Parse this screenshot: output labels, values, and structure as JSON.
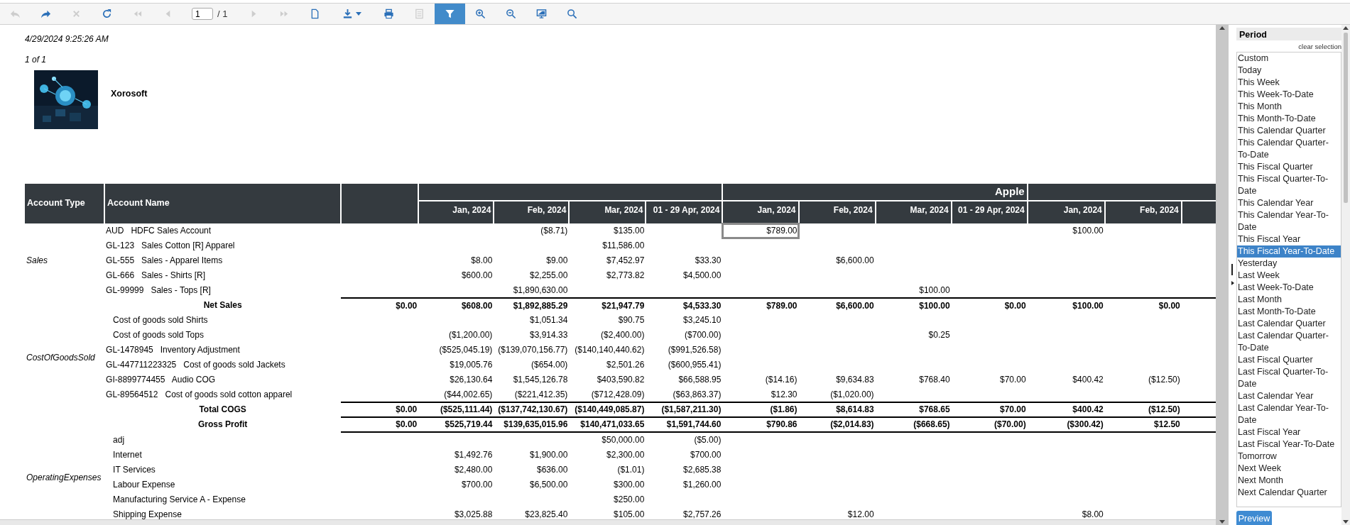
{
  "toolbar": [
    {
      "kind": "undo",
      "disabled": true
    },
    {
      "kind": "redo",
      "disabled": false
    },
    {
      "kind": "close",
      "disabled": true
    },
    {
      "kind": "refresh",
      "disabled": false
    },
    {
      "kind": "first",
      "disabled": true
    },
    {
      "kind": "prev",
      "disabled": true
    },
    {
      "kind": "page",
      "value": "1",
      "total": "/ 1"
    },
    {
      "kind": "next",
      "disabled": true
    },
    {
      "kind": "last",
      "disabled": true
    },
    {
      "kind": "document",
      "disabled": false
    },
    {
      "kind": "download",
      "disabled": false
    },
    {
      "kind": "print",
      "disabled": false
    },
    {
      "kind": "report",
      "disabled": true
    },
    {
      "kind": "filter",
      "disabled": false,
      "on": true
    },
    {
      "kind": "zoomin",
      "disabled": false
    },
    {
      "kind": "zoomout",
      "disabled": false
    },
    {
      "kind": "monitor",
      "disabled": false
    },
    {
      "kind": "search",
      "disabled": false
    }
  ],
  "report": {
    "timestamp": "4/29/2024 9:25:26 AM",
    "page_of": "1 of 1",
    "company": "Xorosoft",
    "table": {
      "columns": [
        "Account Type",
        "Account Name"
      ],
      "groups": [
        {
          "columns": [
            "Jan, 2024",
            "Feb, 2024",
            "Mar, 2024",
            "01 - 29 Apr, 2024"
          ]
        },
        {
          "label": "Apple",
          "columns": [
            "Jan, 2024",
            "Feb, 2024",
            "Mar, 2024",
            "01 - 29 Apr, 2024"
          ]
        },
        {
          "columns": [
            "Jan, 2024",
            "Feb, 2024"
          ]
        }
      ],
      "body": [
        {
          "kind": "group",
          "type": "Sales",
          "rows": [
            {
              "code": "AUD",
              "name": "HDFC Sales Account",
              "values": {
                "c2": "($8.71)",
                "c3": "$135.00",
                "c5": {
                  "text": "$789.00",
                  "focused": true
                },
                "c9": "$100.00"
              }
            },
            {
              "code": "GL-123",
              "name": "Sales Cotton [R] Apparel",
              "values": {
                "c3": "$11,586.00"
              }
            },
            {
              "code": "GL-555",
              "name": "Sales - Apparel Items",
              "values": {
                "c1": "$8.00",
                "c2": "$9.00",
                "c3": "$7,452.97",
                "c4": "$33.30",
                "c6": "$6,600.00"
              }
            },
            {
              "code": "GL-666",
              "name": "Sales - Shirts [R]",
              "values": {
                "c1": "$600.00",
                "c2": "$2,255.00",
                "c3": "$2,773.82",
                "c4": "$4,500.00"
              }
            },
            {
              "code": "GL-99999",
              "name": "Sales - Tops [R]",
              "values": {
                "c2": "$1,890,630.00",
                "c7": "$100.00"
              }
            }
          ]
        },
        {
          "kind": "total",
          "label": "Net Sales",
          "values": {
            "c0": "$0.00",
            "c1": "$608.00",
            "c2": "$1,892,885.29",
            "c3": "$21,947.79",
            "c4": "$4,533.30",
            "c5": "$789.00",
            "c6": "$6,600.00",
            "c7": "$100.00",
            "c8": "$0.00",
            "c9": "$100.00",
            "c10": "$0.00"
          }
        },
        {
          "kind": "group",
          "type": "CostOfGoodsSold",
          "rows": [
            {
              "name": "Cost of goods sold Shirts",
              "values": {
                "c2": "$1,051.34",
                "c3": "$90.75",
                "c4": "$3,245.10"
              }
            },
            {
              "name": "Cost of goods sold Tops",
              "values": {
                "c1": "($1,200.00)",
                "c2": "$3,914.33",
                "c3": "($2,400.00)",
                "c4": "($700.00)",
                "c7": "$0.25"
              }
            },
            {
              "code": "GL-1478945",
              "name": "Inventory Adjustment",
              "values": {
                "c1": "($525,045.19)",
                "c2": "($139,070,156.77)",
                "c3": "($140,140,440.62)",
                "c4": "($991,526.58)"
              }
            },
            {
              "code": "GL-447711223325",
              "name": "Cost of goods sold Jackets",
              "values": {
                "c1": "$19,005.76",
                "c2": "($654.00)",
                "c3": "$2,501.26",
                "c4": "($600,955.41)"
              }
            },
            {
              "code": "GI-8899774455",
              "name": "Audio COG",
              "values": {
                "c1": "$26,130.64",
                "c2": "$1,545,126.78",
                "c3": "$403,590.82",
                "c4": "$66,588.95",
                "c5": "($14.16)",
                "c6": "$9,634.83",
                "c7": "$768.40",
                "c8": "$70.00",
                "c9": "$400.42",
                "c10": "($12.50)"
              }
            },
            {
              "code": "GL-89564512",
              "name": "Cost of goods sold cotton apparel",
              "values": {
                "c1": "($44,002.65)",
                "c2": "($221,412.35)",
                "c3": "($712,428.09)",
                "c4": "($63,863.37)",
                "c5": "$12.30",
                "c6": "($1,020.00)"
              }
            }
          ]
        },
        {
          "kind": "total",
          "label": "Total COGS",
          "values": {
            "c0": "$0.00",
            "c1": "($525,111.44)",
            "c2": "($137,742,130.67)",
            "c3": "($140,449,085.87)",
            "c4": "($1,587,211.30)",
            "c5": "($1.86)",
            "c6": "$8,614.83",
            "c7": "$768.65",
            "c8": "$70.00",
            "c9": "$400.42",
            "c10": "($12.50)"
          }
        },
        {
          "kind": "total",
          "label": "Gross Profit",
          "values": {
            "c0": "$0.00",
            "c1": "$525,719.44",
            "c2": "$139,635,015.96",
            "c3": "$140,471,033.65",
            "c4": "$1,591,744.60",
            "c5": "$790.86",
            "c6": "($2,014.83)",
            "c7": "($668.65)",
            "c8": "($70.00)",
            "c9": "($300.42)",
            "c10": "$12.50"
          }
        },
        {
          "kind": "rule"
        },
        {
          "kind": "group",
          "type": "OperatingExpenses",
          "rows": [
            {
              "name": "adj",
              "values": {
                "c3": "$50,000.00",
                "c4": "($5.00)"
              }
            },
            {
              "name": "Internet",
              "values": {
                "c1": "$1,492.76",
                "c2": "$1,900.00",
                "c3": "$2,300.00",
                "c4": "$700.00"
              }
            },
            {
              "name": "IT Services",
              "values": {
                "c1": "$2,480.00",
                "c2": "$636.00",
                "c3": "($1.01)",
                "c4": "$2,685.38"
              }
            },
            {
              "name": "Labour Expense",
              "values": {
                "c1": "$700.00",
                "c2": "$6,500.00",
                "c3": "$300.00",
                "c4": "$1,260.00"
              }
            },
            {
              "name": "Manufacturing Service A - Expense",
              "values": {
                "c3": "$250.00"
              }
            },
            {
              "name": "Shipping Expense",
              "values": {
                "c1": "$3,025.88",
                "c2": "$23,825.40",
                "c3": "$105.00",
                "c4": "$2,757.26",
                "c6": "$12.00",
                "c9": "$8.00"
              }
            }
          ]
        }
      ]
    }
  },
  "panel": {
    "title": "Period",
    "clear_link": "clear selection",
    "options": [
      {
        "label": "Custom",
        "selected": false
      },
      {
        "label": "Today",
        "selected": false
      },
      {
        "label": "This Week",
        "selected": false
      },
      {
        "label": "This Week-To-Date",
        "selected": false
      },
      {
        "label": "This Month",
        "selected": false
      },
      {
        "label": "This Month-To-Date",
        "selected": false
      },
      {
        "label": "This Calendar Quarter",
        "selected": false
      },
      {
        "label": "This Calendar Quarter-To-Date",
        "selected": false
      },
      {
        "label": "This Fiscal Quarter",
        "selected": false
      },
      {
        "label": "This Fiscal Quarter-To-Date",
        "selected": false
      },
      {
        "label": "This Calendar Year",
        "selected": false
      },
      {
        "label": "This Calendar Year-To-Date",
        "selected": false
      },
      {
        "label": "This Fiscal Year",
        "selected": false
      },
      {
        "label": "This Fiscal Year-To-Date",
        "selected": true
      },
      {
        "label": "Yesterday",
        "selected": false
      },
      {
        "label": "Last Week",
        "selected": false
      },
      {
        "label": "Last Week-To-Date",
        "selected": false
      },
      {
        "label": "Last Month",
        "selected": false
      },
      {
        "label": "Last Month-To-Date",
        "selected": false
      },
      {
        "label": "Last Calendar Quarter",
        "selected": false
      },
      {
        "label": "Last Calendar Quarter-To-Date",
        "selected": false
      },
      {
        "label": "Last Fiscal Quarter",
        "selected": false
      },
      {
        "label": "Last Fiscal Quarter-To-Date",
        "selected": false
      },
      {
        "label": "Last Calendar Year",
        "selected": false
      },
      {
        "label": "Last Calendar Year-To-Date",
        "selected": false
      },
      {
        "label": "Last Fiscal Year",
        "selected": false
      },
      {
        "label": "Last Fiscal Year-To-Date",
        "selected": false
      },
      {
        "label": "Tomorrow",
        "selected": false
      },
      {
        "label": "Next Week",
        "selected": false
      },
      {
        "label": "Next Month",
        "selected": false
      },
      {
        "label": "Next Calendar Quarter",
        "selected": false
      }
    ],
    "button": "Preview"
  }
}
